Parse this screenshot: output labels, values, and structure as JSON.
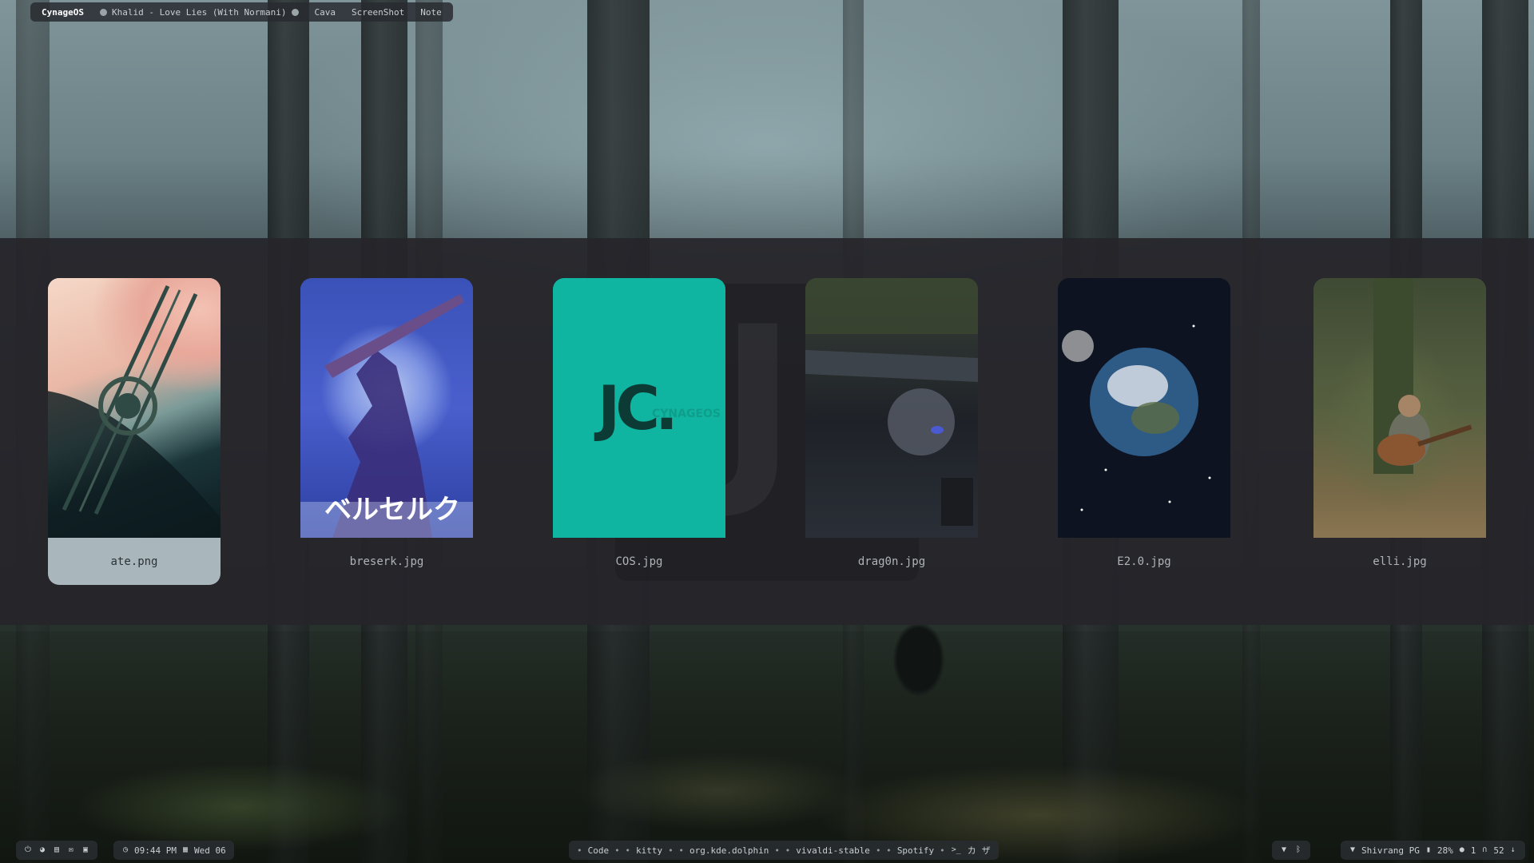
{
  "topbar": {
    "brand": "CynageOS",
    "now_playing": "Khalid - Love Lies (With Normani)",
    "items": [
      "Cava",
      "ScreenShot",
      "Note"
    ]
  },
  "picker": {
    "ghost_text": "JC",
    "wallpapers": [
      {
        "file": "ate.png",
        "selected": true
      },
      {
        "file": "breserk.jpg",
        "selected": false
      },
      {
        "file": "COS.jpg",
        "selected": false
      },
      {
        "file": "drag0n.jpg",
        "selected": false
      },
      {
        "file": "E2.0.jpg",
        "selected": false
      },
      {
        "file": "elli.jpg",
        "selected": false
      }
    ],
    "breserk_title": "ベルセルク",
    "cos_logo": "JC.",
    "cos_logo_sub": "CYNAGEOS"
  },
  "bottombar": {
    "time": "09:44 PM",
    "date": "Wed 06",
    "tasks": [
      "Code",
      "kitty",
      "org.kde.dolphin",
      "vivaldi-stable",
      "Spotify"
    ],
    "glyph_1": "カ",
    "glyph_2": "ザ",
    "wifi_name": "Shivrang PG",
    "battery": "28%",
    "count_a": "1",
    "volume": "52"
  },
  "colors": {
    "selected_card": "#a9b7bd",
    "overlay": "#26252a",
    "cos_teal": "#0fb5a0"
  }
}
